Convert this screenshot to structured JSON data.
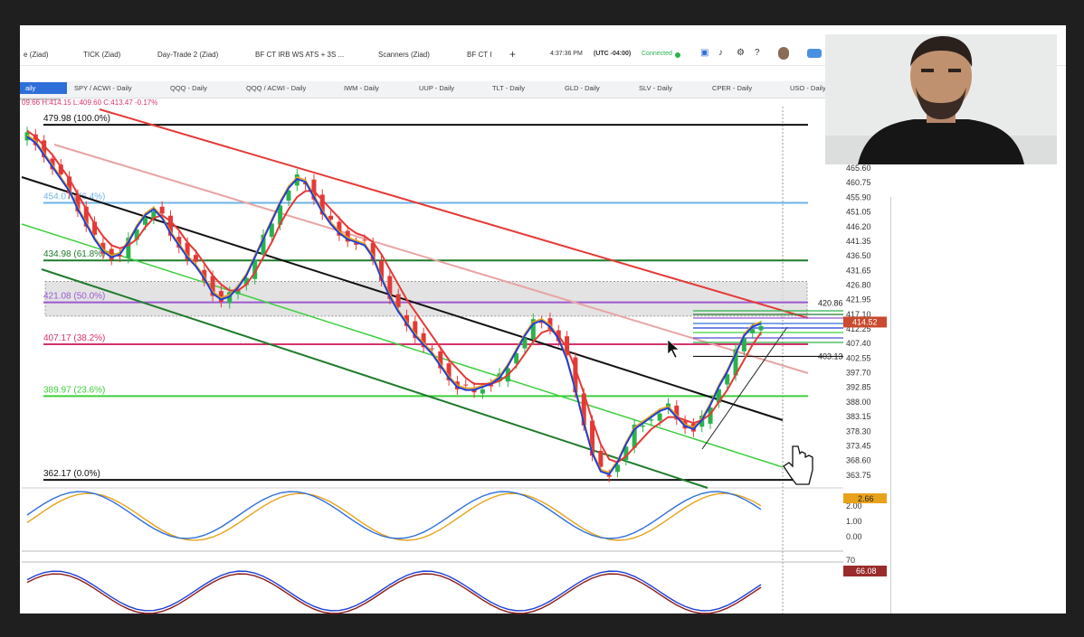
{
  "toptabs": [
    {
      "label": "e (Ziad)"
    },
    {
      "label": "TICK (Ziad)"
    },
    {
      "label": "Day-Trade 2 (Ziad)"
    },
    {
      "label": "BF CT IRB WS ATS + 3S ..."
    },
    {
      "label": "Scanners (Ziad)"
    },
    {
      "label": "BF CT I"
    },
    {
      "label": "+"
    }
  ],
  "status": {
    "time": "4:37:36 PM",
    "tz": "(UTC -04:00)",
    "connection": "Connected"
  },
  "toolbar_icons": [
    "save-icon",
    "bell-icon",
    "gear-icon",
    "help-icon",
    "avatar",
    "logo-icon"
  ],
  "chart_tabs": [
    {
      "label": "aily",
      "active": true
    },
    {
      "label": "SPY / ACWI - Daily"
    },
    {
      "label": "QQQ - Daily"
    },
    {
      "label": "QQQ / ACWI - Daily"
    },
    {
      "label": "IWM - Daily"
    },
    {
      "label": "UUP - Daily"
    },
    {
      "label": "TLT - Daily"
    },
    {
      "label": "GLD - Daily"
    },
    {
      "label": "SLV - Daily"
    },
    {
      "label": "CPER - Daily"
    },
    {
      "label": "USO - Daily"
    }
  ],
  "ohlc": "09.66 H:414.15 L:409.60 C:413.47 -0.17%",
  "chart_data": [
    {
      "type": "line",
      "title": "",
      "ylim": [
        359.5,
        486
      ],
      "yticks": [
        465.6,
        460.75,
        455.9,
        451.05,
        446.2,
        441.35,
        436.5,
        431.65,
        426.8,
        421.95,
        417.1,
        412.25,
        407.4,
        402.55,
        397.7,
        392.85,
        388.0,
        383.15,
        378.3,
        373.45,
        368.6,
        363.75
      ],
      "fib_levels": [
        {
          "label": "479.98 (100.0%)",
          "value": 479.98,
          "color": "#111111"
        },
        {
          "label": "454.07 (76.4%)",
          "value": 454.07,
          "color": "#6fb3e8"
        },
        {
          "label": "434.98 (61.8%)",
          "value": 434.98,
          "color": "#1e7b2a"
        },
        {
          "label": "421.08 (50.0%)",
          "value": 421.08,
          "color": "#9b59d0"
        },
        {
          "label": "407.17 (38.2%)",
          "value": 407.17,
          "color": "#d6336c"
        },
        {
          "label": "389.97 (23.6%)",
          "value": 389.97,
          "color": "#3ccf3c"
        },
        {
          "label": "362.17 (0.0%)",
          "value": 362.17,
          "color": "#111111"
        }
      ],
      "right_labels": [
        {
          "label": "420.86",
          "value": 420.86
        },
        {
          "label": "414.52",
          "value": 414.52
        },
        {
          "label": "403.13",
          "value": 403.13
        }
      ],
      "series": [
        {
          "values": [
            476,
            474,
            470,
            466,
            462,
            458,
            452,
            447,
            442,
            438,
            436,
            437,
            441,
            446,
            450,
            452,
            449,
            444,
            440,
            436,
            433,
            429,
            424,
            422,
            423,
            426,
            430,
            436,
            442,
            448,
            454,
            459,
            462,
            461,
            456,
            451,
            447,
            444,
            442,
            441,
            440,
            436,
            429,
            423,
            418,
            414,
            410,
            407,
            404,
            400,
            396,
            393,
            392,
            392,
            393,
            394,
            396,
            400,
            405,
            410,
            414,
            415,
            413,
            409,
            402,
            392,
            381,
            371,
            365,
            364,
            368,
            374,
            379,
            381,
            383,
            385,
            386,
            383,
            380,
            379,
            382,
            387,
            393,
            398,
            404,
            410,
            413,
            414
          ]
        },
        {
          "values": [
            478,
            476,
            473,
            470,
            466,
            462,
            457,
            452,
            447,
            443,
            440,
            439,
            440,
            442,
            446,
            449,
            450,
            448,
            445,
            441,
            438,
            434,
            430,
            427,
            425,
            425,
            427,
            431,
            436,
            441,
            447,
            452,
            456,
            458,
            458,
            455,
            452,
            449,
            446,
            444,
            443,
            441,
            437,
            432,
            427,
            422,
            418,
            414,
            410,
            406,
            402,
            399,
            396,
            394,
            394,
            394,
            395,
            397,
            400,
            404,
            408,
            411,
            412,
            410,
            406,
            399,
            391,
            382,
            374,
            369,
            368,
            370,
            373,
            376,
            379,
            381,
            383,
            383,
            382,
            381,
            382,
            384,
            388,
            392,
            397,
            402,
            407,
            411
          ]
        }
      ]
    },
    {
      "type": "line",
      "title": "",
      "yticks": [
        2.0,
        1.0,
        0.0
      ],
      "last_value": "2.66"
    },
    {
      "type": "line",
      "title": "",
      "yticks": [
        70
      ],
      "last_value": "66.08"
    }
  ],
  "colors": {
    "accent": "#2f6fd9",
    "candle_up": "#2bb24c",
    "candle_down": "#e53935",
    "sma_fast": "#1f3fd6",
    "sma_slow": "#e53935",
    "sma_mid": "#e8a21a",
    "connected": "#2bb24c"
  }
}
